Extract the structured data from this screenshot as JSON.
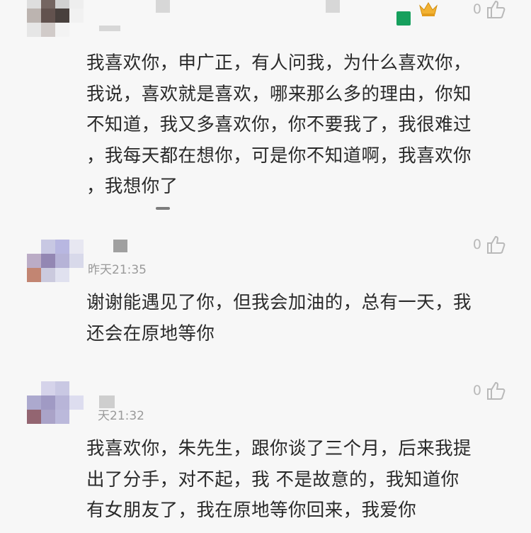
{
  "comments": [
    {
      "timestamp": "",
      "likes": "0",
      "text": "我喜欢你，申广正，有人问我，为什么喜欢你，\n我说，喜欢就是喜欢，哪来那么多的理由，你知\n不知道，我又多喜欢你，你不要我了，我很难过\n，我每天都在想你，可是你不知道啊，我喜欢你\n，我想你了"
    },
    {
      "timestamp": "昨天21:35",
      "likes": "0",
      "text": "谢谢能遇见了你，但我会加油的，总有一天，我\n还会在原地等你"
    },
    {
      "timestamp": "天21:32",
      "likes": "0",
      "text": "我喜欢你，朱先生，跟你谈了三个月，后来我提\n出了分手，对不起，我 不是故意的，我知道你\n有女朋友了，我在原地等你回来，我爱你"
    }
  ],
  "colors": {
    "background": "#f7f7f7",
    "badge_green": "#16a05d",
    "crown_gold": "#f2b233",
    "like_gray": "#b9b9b9"
  },
  "icons": [
    "thumbs-up-icon",
    "crown-icon",
    "level-badge-icon"
  ]
}
